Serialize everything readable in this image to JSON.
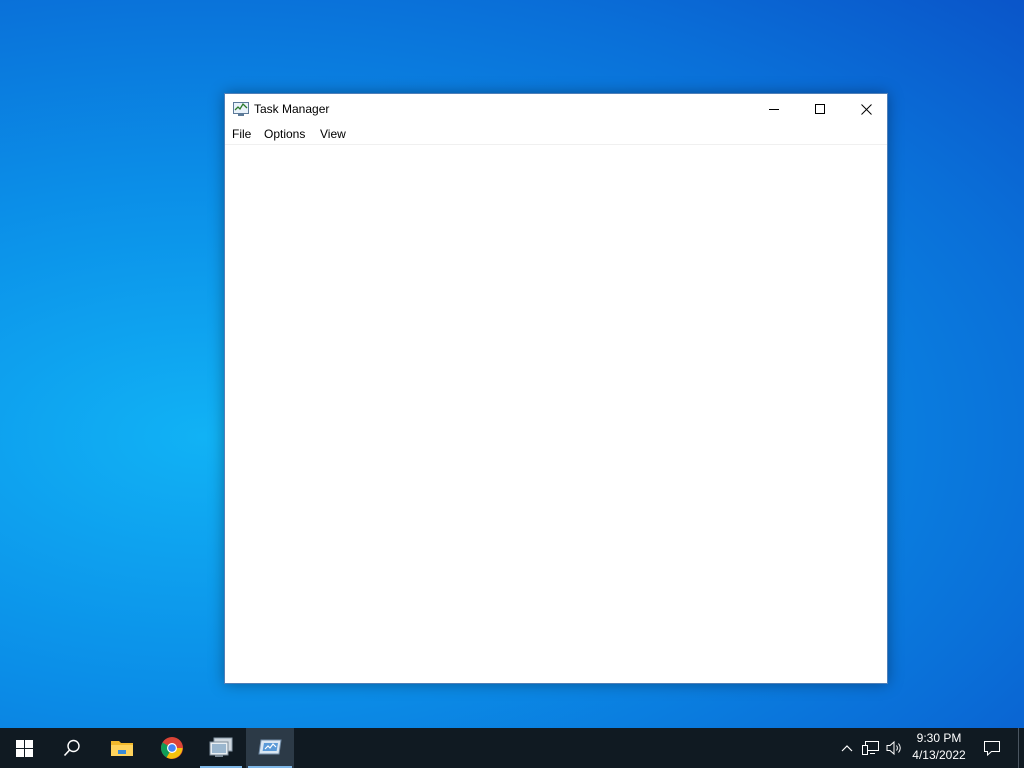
{
  "window": {
    "title": "Task Manager",
    "menu": [
      "File",
      "Options",
      "View"
    ]
  },
  "taskbar": {
    "items": [
      {
        "name": "start",
        "icon": "windows-logo-icon"
      },
      {
        "name": "search",
        "icon": "search-icon"
      },
      {
        "name": "file-explorer",
        "icon": "folder-icon"
      },
      {
        "name": "chrome",
        "icon": "chrome-icon"
      },
      {
        "name": "app-1",
        "icon": "computer-icon"
      },
      {
        "name": "app-2",
        "icon": "task-manager-icon"
      }
    ],
    "tray": {
      "icons": [
        "chevron-up-icon",
        "network-icon",
        "volume-icon"
      ],
      "time": "9:30 PM",
      "date": "4/13/2022",
      "notification_icon": "notification-icon"
    }
  },
  "colors": {
    "desktop": "#0b8fe8",
    "taskbar": "#101a22",
    "window_bg": "#ffffff",
    "active_underline": "#7fb8e8"
  }
}
